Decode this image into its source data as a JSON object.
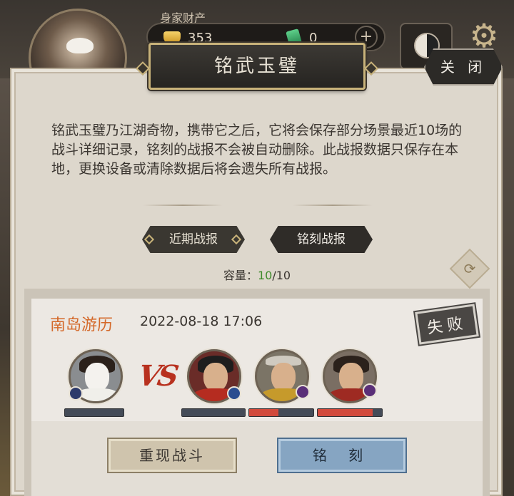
{
  "hud": {
    "wealth_label": "身家财产",
    "gold": "353",
    "jade": "0",
    "plus": "+"
  },
  "dialog": {
    "title": "铭武玉璧",
    "close_label": "关 闭",
    "description": "铭武玉璧乃江湖奇物，携带它之后，它将会保存部分场景最近10场的战斗详细记录，铭刻的战报不会被自动删除。此战报数据只保存在本地，更换设备或清除数据后将会遗失所有战报。",
    "tabs": [
      {
        "label": "近期战报"
      },
      {
        "label": "铭刻战报"
      }
    ],
    "capacity_label": "容量：",
    "capacity_current": "10",
    "capacity_max": "/10"
  },
  "record": {
    "location": "南岛游历",
    "datetime": "2022-08-18 17:06",
    "result": "失败",
    "vs": "VS",
    "ally_hp": [
      0
    ],
    "enemy_hp": [
      0,
      0.45,
      0.85
    ],
    "replay_label": "重现战斗",
    "engrave_label": "铭 刻"
  }
}
